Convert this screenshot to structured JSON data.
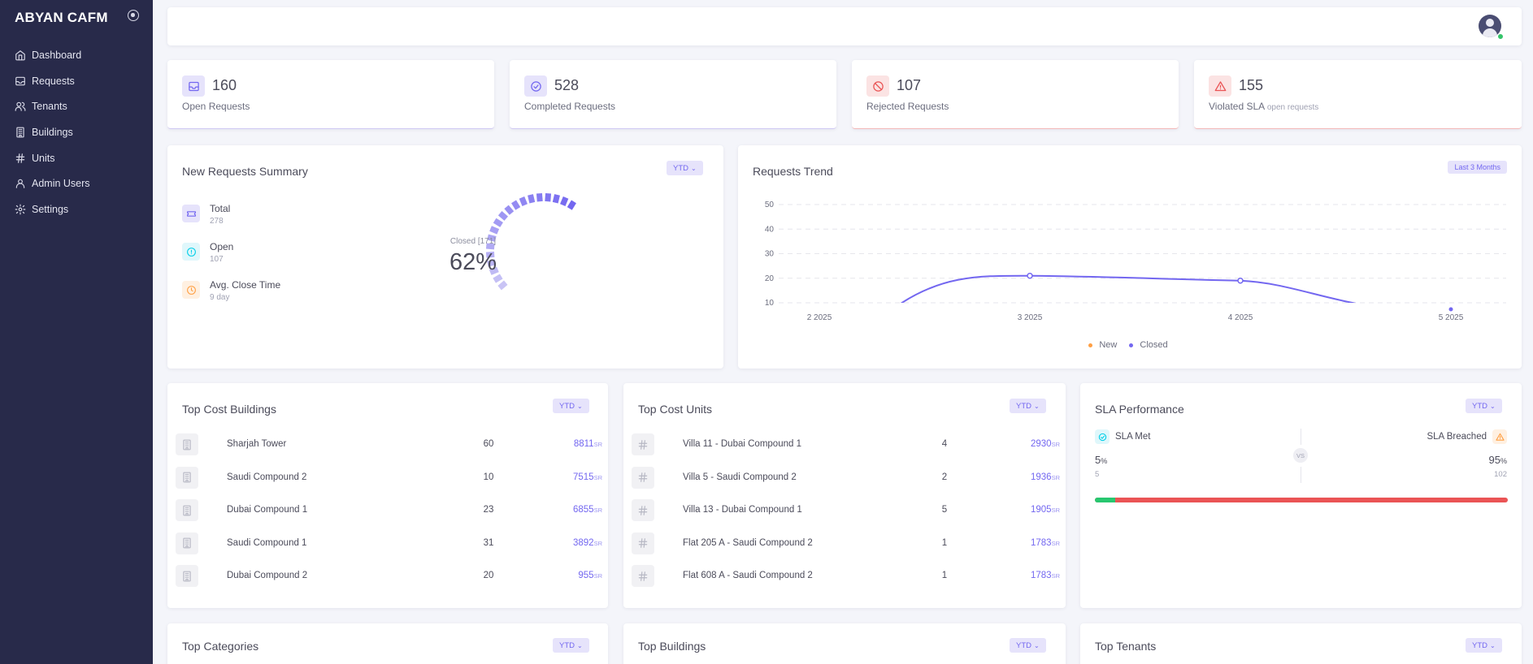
{
  "app": {
    "name": "ABYAN CAFM"
  },
  "sidebar": {
    "items": [
      {
        "label": "Dashboard",
        "icon": "home-icon"
      },
      {
        "label": "Requests",
        "icon": "inbox-icon"
      },
      {
        "label": "Tenants",
        "icon": "users-icon"
      },
      {
        "label": "Buildings",
        "icon": "building-icon"
      },
      {
        "label": "Units",
        "icon": "hash-icon"
      },
      {
        "label": "Admin Users",
        "icon": "user-icon"
      },
      {
        "label": "Settings",
        "icon": "gear-icon"
      }
    ]
  },
  "stats": [
    {
      "value": "160",
      "label": "Open Requests",
      "sublabel": "",
      "icon": "inbox-icon",
      "color": "#7367f0"
    },
    {
      "value": "528",
      "label": "Completed Requests",
      "sublabel": "",
      "icon": "check-circle-icon",
      "color": "#7367f0"
    },
    {
      "value": "107",
      "label": "Rejected Requests",
      "sublabel": "",
      "icon": "ban-icon",
      "color": "#ea5455"
    },
    {
      "value": "155",
      "label": "Violated SLA",
      "sublabel": "open requests",
      "icon": "alert-triangle-icon",
      "color": "#ea5455"
    }
  ],
  "summary": {
    "title": "New Requests Summary",
    "filter": "YTD",
    "items": [
      {
        "label": "Total",
        "value": "278",
        "icon": "ticket-icon"
      },
      {
        "label": "Open",
        "value": "107",
        "icon": "info-icon"
      },
      {
        "label": "Avg. Close Time",
        "value": "9 day",
        "icon": "clock-icon"
      }
    ],
    "gauge_label": "Closed [171]",
    "gauge_value": "62%",
    "gauge_percent": 62
  },
  "trend": {
    "title": "Requests Trend",
    "filter": "Last 3 Months",
    "legend": [
      {
        "label": "New",
        "color": "#ff9f43"
      },
      {
        "label": "Closed",
        "color": "#7367f0"
      }
    ]
  },
  "chart_data": {
    "type": "line",
    "x": [
      "2 2025",
      "3 2025",
      "4 2025",
      "5 2025"
    ],
    "yticks": [
      50,
      40,
      30,
      20,
      10
    ],
    "series": [
      {
        "name": "New",
        "values": []
      },
      {
        "name": "Closed",
        "values": [
          null,
          21,
          19,
          8
        ]
      }
    ],
    "ylim": [
      10,
      50
    ],
    "grid": true,
    "legend_position": "bottom"
  },
  "top_cost_buildings": {
    "title": "Top Cost Buildings",
    "filter": "YTD",
    "currency": "SR",
    "rows": [
      {
        "name": "Sharjah Tower",
        "count": "60",
        "cost": "8811"
      },
      {
        "name": "Saudi Compound 2",
        "count": "10",
        "cost": "7515"
      },
      {
        "name": "Dubai Compound 1",
        "count": "23",
        "cost": "6855"
      },
      {
        "name": "Saudi Compound 1",
        "count": "31",
        "cost": "3892"
      },
      {
        "name": "Dubai Compound 2",
        "count": "20",
        "cost": "955"
      }
    ]
  },
  "top_cost_units": {
    "title": "Top Cost Units",
    "filter": "YTD",
    "currency": "SR",
    "rows": [
      {
        "name": "Villa 11 - Dubai Compound 1",
        "count": "4",
        "cost": "2930"
      },
      {
        "name": "Villa 5 - Saudi Compound 2",
        "count": "2",
        "cost": "1936"
      },
      {
        "name": "Villa 13 - Dubai Compound 1",
        "count": "5",
        "cost": "1905"
      },
      {
        "name": "Flat 205 A - Saudi Compound 2",
        "count": "1",
        "cost": "1783"
      },
      {
        "name": "Flat 608 A - Saudi Compound 2",
        "count": "1",
        "cost": "1783"
      }
    ]
  },
  "sla": {
    "title": "SLA Performance",
    "filter": "YTD",
    "met_label": "SLA Met",
    "breached_label": "SLA Breached",
    "met_percent": "5",
    "met_count": "5",
    "breached_percent": "95",
    "breached_count": "102",
    "percent_unit": "%",
    "vs": "VS",
    "met_fraction": 0.05,
    "met_color": "#28c76f",
    "breached_color": "#ea5455"
  },
  "bottom_cards": [
    {
      "title": "Top Categories",
      "filter": "YTD"
    },
    {
      "title": "Top Buildings",
      "filter": "YTD"
    },
    {
      "title": "Top Tenants",
      "filter": "YTD"
    }
  ]
}
